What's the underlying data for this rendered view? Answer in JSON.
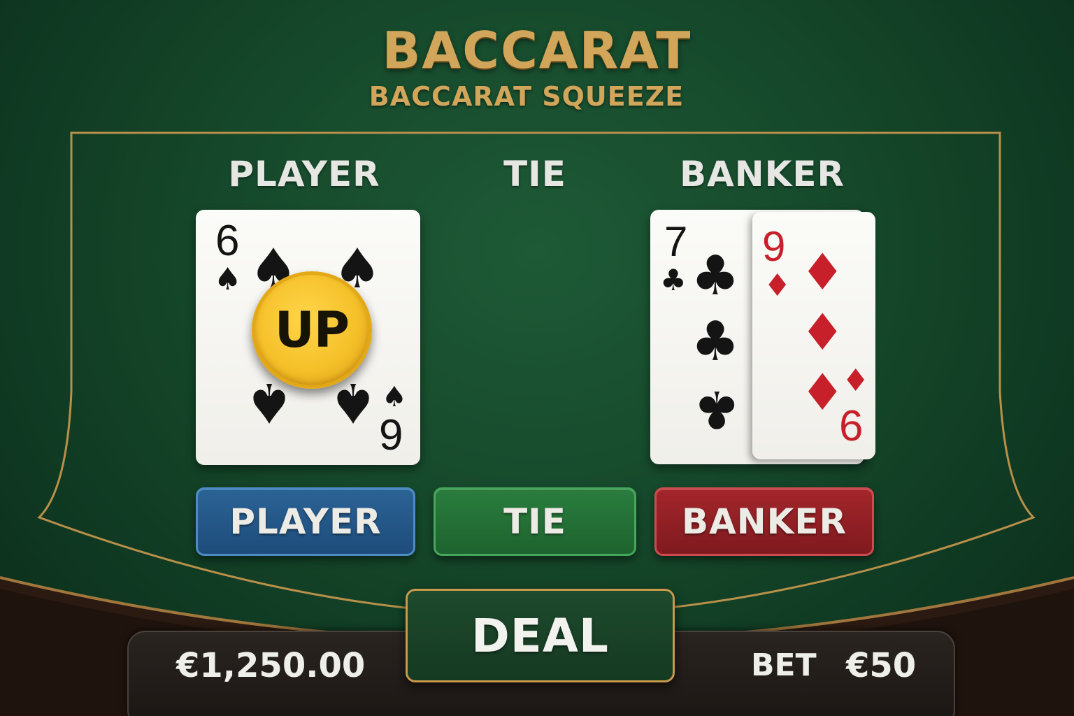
{
  "header": {
    "title": "BACCARAT",
    "subtitle": "BACCARAT SQUEEZE"
  },
  "table": {
    "areas": {
      "player": "PLAYER",
      "tie": "TIE",
      "banker": "BANKER"
    }
  },
  "player_hand": {
    "cards": [
      {
        "rank_top": "6",
        "rank_bottom": "9",
        "suit": "spades",
        "suit_symbol": "♠",
        "color": "#141414"
      }
    ],
    "chip_label": "UP"
  },
  "banker_hand": {
    "cards": [
      {
        "rank": "7",
        "suit": "clubs",
        "suit_symbol": "♣",
        "color": "#141414"
      },
      {
        "rank_top": "9",
        "rank_bottom": "6",
        "suit": "diamonds",
        "suit_symbol": "♦",
        "color": "#c8202a"
      }
    ]
  },
  "bet_buttons": {
    "player": {
      "label": "PLAYER",
      "color": "#1d4c7a"
    },
    "tie": {
      "label": "TIE",
      "color": "#1e632f"
    },
    "banker": {
      "label": "BANKER",
      "color": "#7f1a1f"
    }
  },
  "footer": {
    "balance": "€1,250.00",
    "bet_label": "BET",
    "bet_amount": "€50",
    "deal_label": "DEAL"
  },
  "colors": {
    "felt": "#15472a",
    "gold": "#d2a65a",
    "chip": "#f5c12a"
  }
}
